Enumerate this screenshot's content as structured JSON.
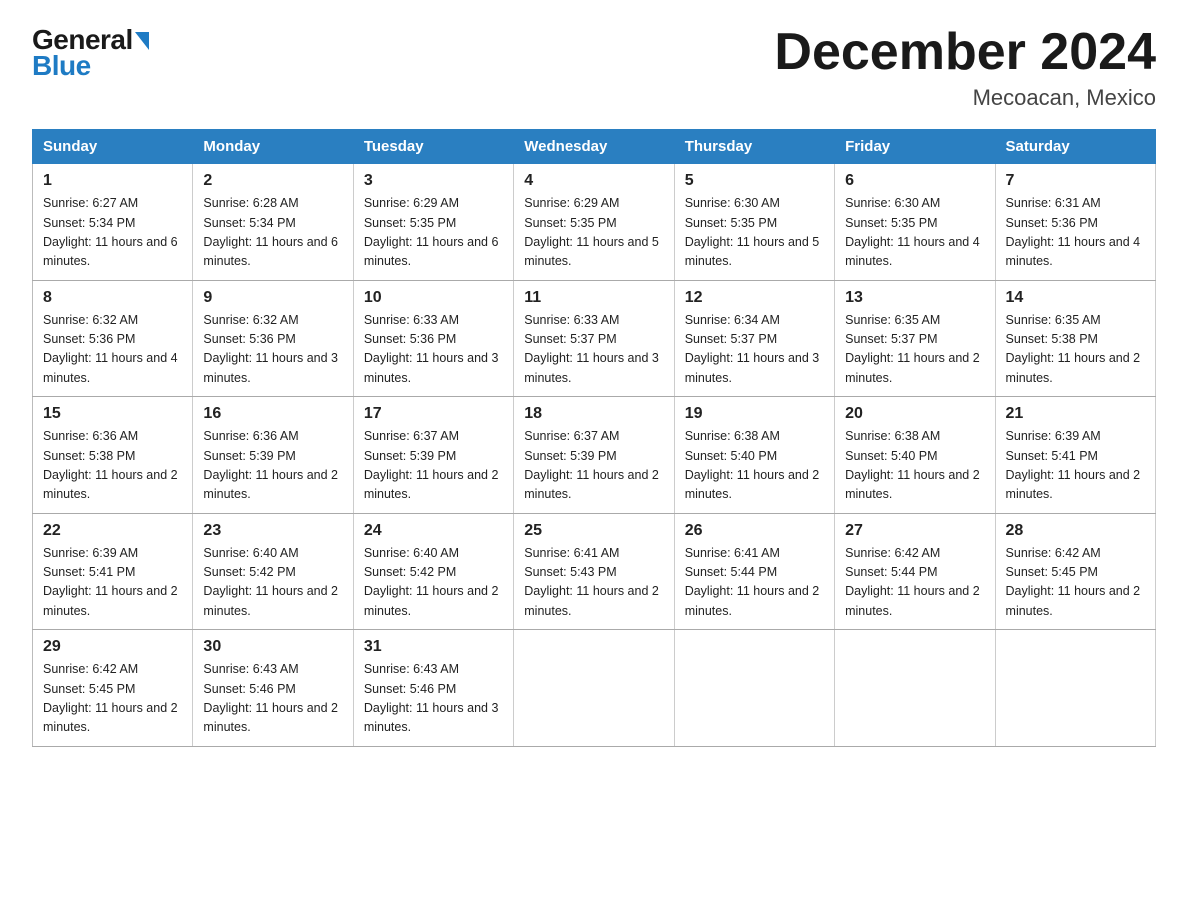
{
  "header": {
    "logo_top": "General",
    "logo_bottom": "Blue",
    "month_title": "December 2024",
    "location": "Mecoacan, Mexico"
  },
  "days_of_week": [
    "Sunday",
    "Monday",
    "Tuesday",
    "Wednesday",
    "Thursday",
    "Friday",
    "Saturday"
  ],
  "weeks": [
    [
      {
        "day": "1",
        "sunrise": "6:27 AM",
        "sunset": "5:34 PM",
        "daylight": "11 hours and 6 minutes."
      },
      {
        "day": "2",
        "sunrise": "6:28 AM",
        "sunset": "5:34 PM",
        "daylight": "11 hours and 6 minutes."
      },
      {
        "day": "3",
        "sunrise": "6:29 AM",
        "sunset": "5:35 PM",
        "daylight": "11 hours and 6 minutes."
      },
      {
        "day": "4",
        "sunrise": "6:29 AM",
        "sunset": "5:35 PM",
        "daylight": "11 hours and 5 minutes."
      },
      {
        "day": "5",
        "sunrise": "6:30 AM",
        "sunset": "5:35 PM",
        "daylight": "11 hours and 5 minutes."
      },
      {
        "day": "6",
        "sunrise": "6:30 AM",
        "sunset": "5:35 PM",
        "daylight": "11 hours and 4 minutes."
      },
      {
        "day": "7",
        "sunrise": "6:31 AM",
        "sunset": "5:36 PM",
        "daylight": "11 hours and 4 minutes."
      }
    ],
    [
      {
        "day": "8",
        "sunrise": "6:32 AM",
        "sunset": "5:36 PM",
        "daylight": "11 hours and 4 minutes."
      },
      {
        "day": "9",
        "sunrise": "6:32 AM",
        "sunset": "5:36 PM",
        "daylight": "11 hours and 3 minutes."
      },
      {
        "day": "10",
        "sunrise": "6:33 AM",
        "sunset": "5:36 PM",
        "daylight": "11 hours and 3 minutes."
      },
      {
        "day": "11",
        "sunrise": "6:33 AM",
        "sunset": "5:37 PM",
        "daylight": "11 hours and 3 minutes."
      },
      {
        "day": "12",
        "sunrise": "6:34 AM",
        "sunset": "5:37 PM",
        "daylight": "11 hours and 3 minutes."
      },
      {
        "day": "13",
        "sunrise": "6:35 AM",
        "sunset": "5:37 PM",
        "daylight": "11 hours and 2 minutes."
      },
      {
        "day": "14",
        "sunrise": "6:35 AM",
        "sunset": "5:38 PM",
        "daylight": "11 hours and 2 minutes."
      }
    ],
    [
      {
        "day": "15",
        "sunrise": "6:36 AM",
        "sunset": "5:38 PM",
        "daylight": "11 hours and 2 minutes."
      },
      {
        "day": "16",
        "sunrise": "6:36 AM",
        "sunset": "5:39 PM",
        "daylight": "11 hours and 2 minutes."
      },
      {
        "day": "17",
        "sunrise": "6:37 AM",
        "sunset": "5:39 PM",
        "daylight": "11 hours and 2 minutes."
      },
      {
        "day": "18",
        "sunrise": "6:37 AM",
        "sunset": "5:39 PM",
        "daylight": "11 hours and 2 minutes."
      },
      {
        "day": "19",
        "sunrise": "6:38 AM",
        "sunset": "5:40 PM",
        "daylight": "11 hours and 2 minutes."
      },
      {
        "day": "20",
        "sunrise": "6:38 AM",
        "sunset": "5:40 PM",
        "daylight": "11 hours and 2 minutes."
      },
      {
        "day": "21",
        "sunrise": "6:39 AM",
        "sunset": "5:41 PM",
        "daylight": "11 hours and 2 minutes."
      }
    ],
    [
      {
        "day": "22",
        "sunrise": "6:39 AM",
        "sunset": "5:41 PM",
        "daylight": "11 hours and 2 minutes."
      },
      {
        "day": "23",
        "sunrise": "6:40 AM",
        "sunset": "5:42 PM",
        "daylight": "11 hours and 2 minutes."
      },
      {
        "day": "24",
        "sunrise": "6:40 AM",
        "sunset": "5:42 PM",
        "daylight": "11 hours and 2 minutes."
      },
      {
        "day": "25",
        "sunrise": "6:41 AM",
        "sunset": "5:43 PM",
        "daylight": "11 hours and 2 minutes."
      },
      {
        "day": "26",
        "sunrise": "6:41 AM",
        "sunset": "5:44 PM",
        "daylight": "11 hours and 2 minutes."
      },
      {
        "day": "27",
        "sunrise": "6:42 AM",
        "sunset": "5:44 PM",
        "daylight": "11 hours and 2 minutes."
      },
      {
        "day": "28",
        "sunrise": "6:42 AM",
        "sunset": "5:45 PM",
        "daylight": "11 hours and 2 minutes."
      }
    ],
    [
      {
        "day": "29",
        "sunrise": "6:42 AM",
        "sunset": "5:45 PM",
        "daylight": "11 hours and 2 minutes."
      },
      {
        "day": "30",
        "sunrise": "6:43 AM",
        "sunset": "5:46 PM",
        "daylight": "11 hours and 2 minutes."
      },
      {
        "day": "31",
        "sunrise": "6:43 AM",
        "sunset": "5:46 PM",
        "daylight": "11 hours and 3 minutes."
      },
      null,
      null,
      null,
      null
    ]
  ]
}
